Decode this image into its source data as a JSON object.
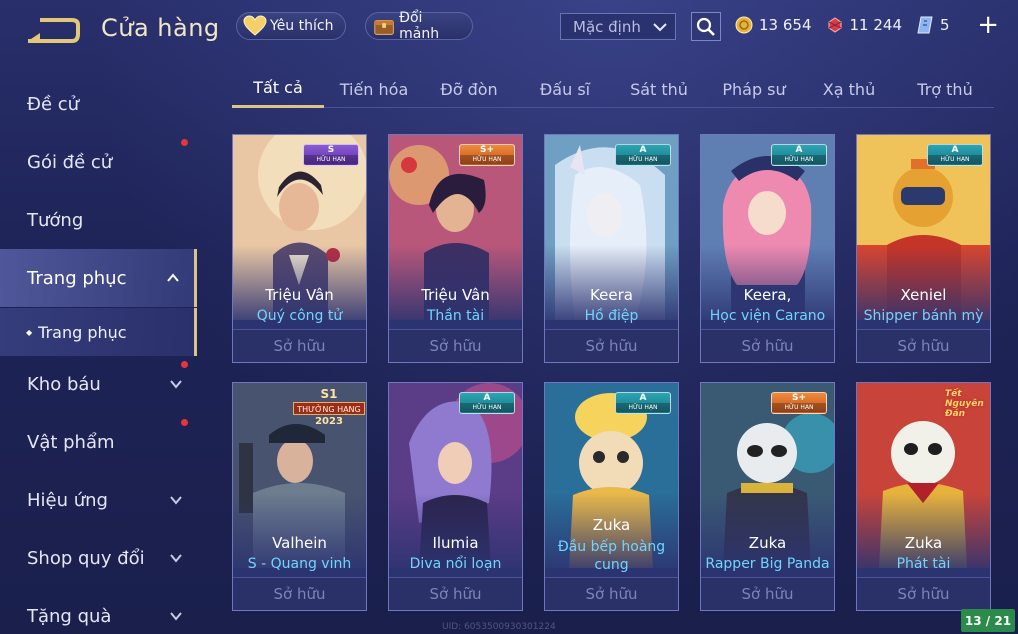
{
  "header": {
    "title": "Cửa hàng",
    "favorites_label": "Yêu thích",
    "exchange_label": "Đổi mảnh",
    "sort": {
      "selected": "Mặc định"
    },
    "currencies": [
      {
        "icon": "gold-coin-icon",
        "value": "13 654"
      },
      {
        "icon": "ruby-icon",
        "value": "11 244"
      },
      {
        "icon": "voucher-icon",
        "value": "5"
      }
    ],
    "plus_label": "+"
  },
  "sidebar": {
    "items": [
      {
        "label": "Đề cử"
      },
      {
        "label": "Gói đề cử"
      },
      {
        "label": "Tướng"
      },
      {
        "label": "Trang phục"
      },
      {
        "label": "Trang phục"
      },
      {
        "label": "Kho báu"
      },
      {
        "label": "Vật phẩm"
      },
      {
        "label": "Hiệu ứng"
      },
      {
        "label": "Shop quy đổi"
      },
      {
        "label": "Tặng quà"
      }
    ]
  },
  "tabs": [
    {
      "label": "Tất cả"
    },
    {
      "label": "Tiến hóa"
    },
    {
      "label": "Đỡ đòn"
    },
    {
      "label": "Đấu sĩ"
    },
    {
      "label": "Sát thủ"
    },
    {
      "label": "Pháp sư"
    },
    {
      "label": "Xạ thủ"
    },
    {
      "label": "Trợ thủ"
    }
  ],
  "cards": [
    {
      "hero": "Triệu Vân",
      "skin": "Quý công tử",
      "badge": "S",
      "badge_sub": "HỮU HẠN",
      "status": "Sở hữu"
    },
    {
      "hero": "Triệu Vân",
      "skin": "Thần tài",
      "badge": "S+",
      "badge_sub": "HỮU HẠN",
      "status": "Sở hữu"
    },
    {
      "hero": "Keera",
      "skin": "Hồ điệp",
      "badge": "A",
      "badge_sub": "HỮU HẠN",
      "status": "Sở hữu"
    },
    {
      "hero": "Keera,",
      "skin": "Học viện Carano",
      "badge": "A",
      "badge_sub": "HỮU HẠN",
      "status": "Sở hữu"
    },
    {
      "hero": "Xeniel",
      "skin": "Shipper bánh mỳ",
      "badge": "A",
      "badge_sub": "HỮU HẠN",
      "status": "Sở hữu"
    },
    {
      "hero": "Valhein",
      "skin": "S - Quang vinh",
      "rank_top": "S1",
      "rank_mid": "THƯỞNG HẠNG",
      "rank_year": "2023",
      "status": "Sở hữu"
    },
    {
      "hero": "Ilumia",
      "skin": "Diva nổi loạn",
      "badge": "A",
      "badge_sub": "HỮU HẠN",
      "status": "Sở hữu"
    },
    {
      "hero": "Zuka",
      "skin_line1": "Đầu bếp hoàng",
      "skin_line2": "cung",
      "badge": "A",
      "badge_sub": "HỮU HẠN",
      "status": "Sở hữu"
    },
    {
      "hero": "Zuka",
      "skin": "Rapper Big Panda",
      "badge": "S+",
      "badge_sub": "HỮU HẠN",
      "status": "Sở hữu"
    },
    {
      "hero": "Zuka",
      "skin": "Phát tài",
      "event": "Tết Nguyên Đán",
      "status": "Sở hữu"
    }
  ],
  "page_counter": "13 / 21",
  "footer_uid": "UID: 6053500930301224",
  "colors": {
    "accent_gold": "#d9c48a",
    "skin_name": "#6fd5ff",
    "notify_red": "#e8353b",
    "counter_green": "#2a8b4a"
  }
}
